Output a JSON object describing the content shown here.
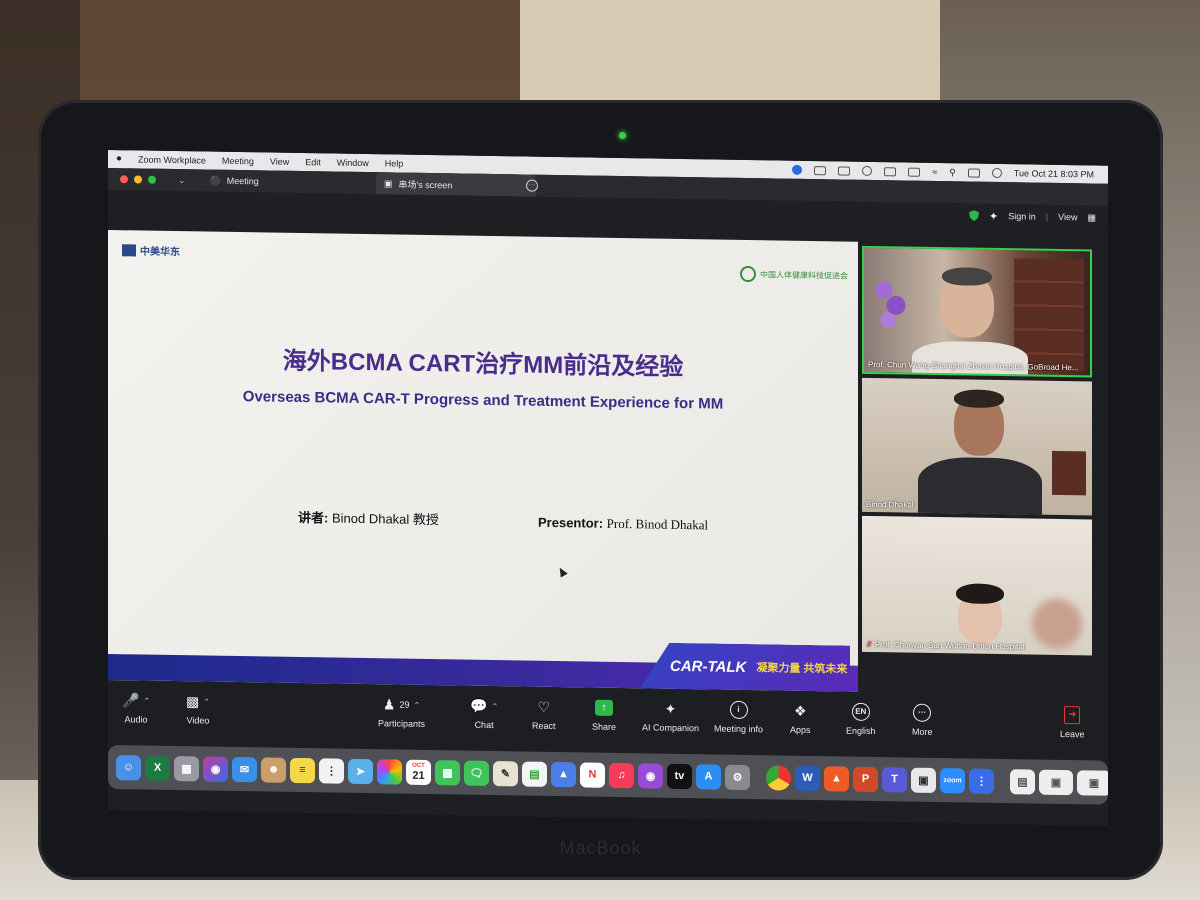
{
  "menubar": {
    "app_name": "Zoom Workplace",
    "menus": [
      "Meeting",
      "View",
      "Edit",
      "Window",
      "Help"
    ],
    "datetime": "Tue Oct 21  8:03 PM"
  },
  "titlebar": {
    "meeting_label": "Meeting",
    "tab_label": "串场's screen"
  },
  "topbar": {
    "signin_label": "Sign in",
    "view_label": "View"
  },
  "slide": {
    "logo_text": "中美华东",
    "org_text": "中国人体健康科技促进会",
    "title_cn": "海外BCMA CART治疗MM前沿及经验",
    "title_en": "Overseas BCMA CAR-T Progress and Treatment Experience for MM",
    "presenter_cn_label": "讲者:",
    "presenter_cn_name": "Binod Dhakal  教授",
    "presenter_en_label": "Presentor:",
    "presenter_en_name": "Prof. Binod Dhakal",
    "banner_text": "CAR-TALK",
    "banner_cn": "凝聚力量 共筑未来"
  },
  "participants_video": [
    {
      "name": "Prof. Chun Wang-Shanghai Zhaxin Hospital, GoBroad He..."
    },
    {
      "name": "Binod Dhakal"
    },
    {
      "name": "Prof. Chunyan Sun Wuhan-Union Hospital"
    }
  ],
  "controls": {
    "audio": "Audio",
    "video": "Video",
    "participants": "Participants",
    "participant_count": "29",
    "chat": "Chat",
    "react": "React",
    "share": "Share",
    "ai_companion": "AI Companion",
    "meeting_info": "Meeting info",
    "apps": "Apps",
    "language": "English",
    "language_code": "EN",
    "more": "More",
    "leave": "Leave"
  },
  "dock": {
    "calendar_day": "21",
    "calendar_month": "OCT",
    "zoom_label": "zoom"
  },
  "device_brand": "MacBook"
}
